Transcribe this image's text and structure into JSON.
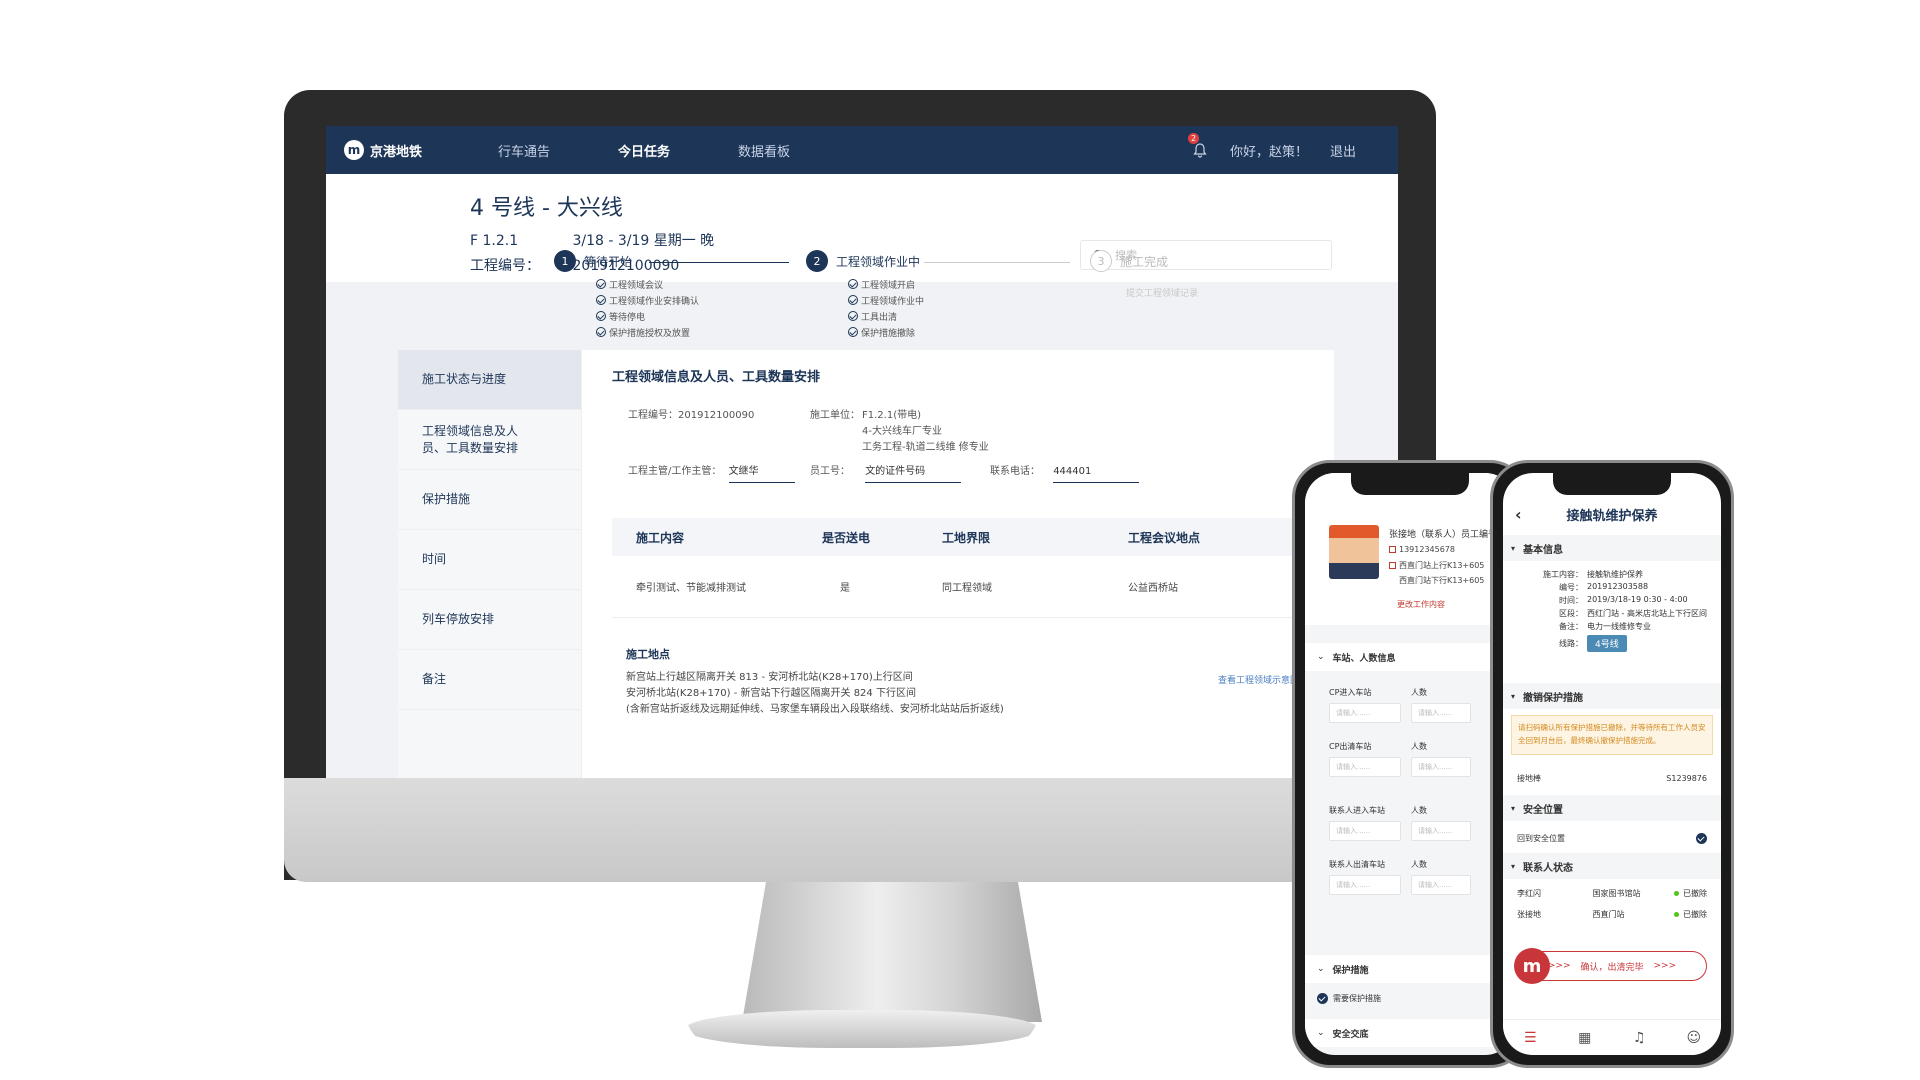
{
  "desktop": {
    "nav": {
      "logo_mark": "m",
      "logo_text": "京港地铁",
      "items": [
        "行车通告",
        "今日任务",
        "数据看板"
      ],
      "notification_count": "2",
      "greeting": "你好，赵策！",
      "logout": "退出"
    },
    "header": {
      "title": "4 号线 - 大兴线",
      "code": "F 1.2.1",
      "date": "3/18 - 3/19  星期一 晚",
      "project_label": "工程编号：",
      "project_no": "201912100090",
      "search_placeholder": "搜索"
    },
    "steps": [
      {
        "num": "1",
        "label": "等待开始",
        "subs": [
          "工程领域会议",
          "工程领域作业安排确认",
          "等待停电",
          "保护措施授权及放置"
        ]
      },
      {
        "num": "2",
        "label": "工程领域作业中",
        "subs": [
          "工程领域开启",
          "工程领域作业中",
          "工具出清",
          "保护措施撤除"
        ]
      },
      {
        "num": "3",
        "label": "施工完成",
        "subs": [
          "提交工程领域记录"
        ]
      }
    ],
    "sidemenu": [
      "施工状态与进度",
      "工程领域信息及人员、工具数量安排",
      "保护措施",
      "时间",
      "列车停放安排",
      "备注"
    ],
    "section_title": "工程领域信息及人员、工具数量安排",
    "info": {
      "project_no": "工程编号：201912100090",
      "unit_label": "施工单位：",
      "unit_lines": [
        "F1.2.1(带电)",
        "4-大兴线车厂专业",
        "工务工程-轨道二线维 修专业"
      ],
      "manager_label": "工程主管/工作主管：",
      "manager_value": "文继华",
      "staff_label": "员工号：",
      "staff_value": "文的证件号码",
      "phone_label": "联系电话：",
      "phone_value": "444401"
    },
    "table": {
      "headers": [
        "施工内容",
        "是否送电",
        "工地界限",
        "工程会议地点"
      ],
      "row": [
        "牵引测试、节能减排测试",
        "是",
        "同工程领域",
        "公益西桥站"
      ]
    },
    "place": {
      "title": "施工地点",
      "lines": [
        "新宫站上行越区隔离开关 813 - 安河桥北站(K28+170)上行区间",
        "安河桥北站(K28+170) - 新宫站下行越区隔离开关 824 下行区间",
        "(含新宫站折返线及远期延伸线、马家堡车辆段出入段联络线、安河桥北站站后折返线)"
      ],
      "link": "查看工程领域示意图"
    }
  },
  "phone1": {
    "name": "张接地（联系人）员工编号",
    "phone": "13912345678",
    "lines": [
      "西直门站上行K13+605",
      "西直门站下行K13+605"
    ],
    "edit": "更改工作内容",
    "section_station": "车站、人数信息",
    "fields": [
      {
        "label": "CP进入车站",
        "count_label": "人数"
      },
      {
        "label": "CP出清车站",
        "count_label": "人数"
      },
      {
        "label": "联系人进入车站",
        "count_label": "人数"
      },
      {
        "label": "联系人出清车站",
        "count_label": "人数"
      }
    ],
    "input_placeholder": "请输入......",
    "input_placeholder_short": "请输入......",
    "section_protect": "保护措施",
    "need_protect": "需要保护措施",
    "section_safety": "安全交底"
  },
  "phone2": {
    "title": "接触轨维护保养",
    "section_basic": "基本信息",
    "basic": [
      {
        "k": "施工内容：",
        "v": "接触轨维护保养"
      },
      {
        "k": "编号：",
        "v": "201912303588"
      },
      {
        "k": "时间：",
        "v": "2019/3/18-19  0:30 - 4:00"
      },
      {
        "k": "区段：",
        "v": "西红门站 - 高米店北站上下行区间"
      },
      {
        "k": "备注：",
        "v": "电力一线维修专业"
      },
      {
        "k": "线路：",
        "v": "4号线"
      }
    ],
    "section_revoke": "撤销保护措施",
    "warning": "请扫码确认所有保护措施已撤除，并等待所有工作人员安全回到月台后，最终确认撤保护措施完成。",
    "ground_label": "接地棒",
    "ground_value": "S1239876",
    "section_safe": "安全位置",
    "safe_label": "回到安全位置",
    "section_contact": "联系人状态",
    "contacts": [
      {
        "name": "李红闪",
        "station": "国家图书馆站",
        "status": "已撤除"
      },
      {
        "name": "张接地",
        "station": "西直门站",
        "status": "已撤除"
      }
    ],
    "confirm": "确认，出清完毕",
    "confirm_logo": "m"
  }
}
